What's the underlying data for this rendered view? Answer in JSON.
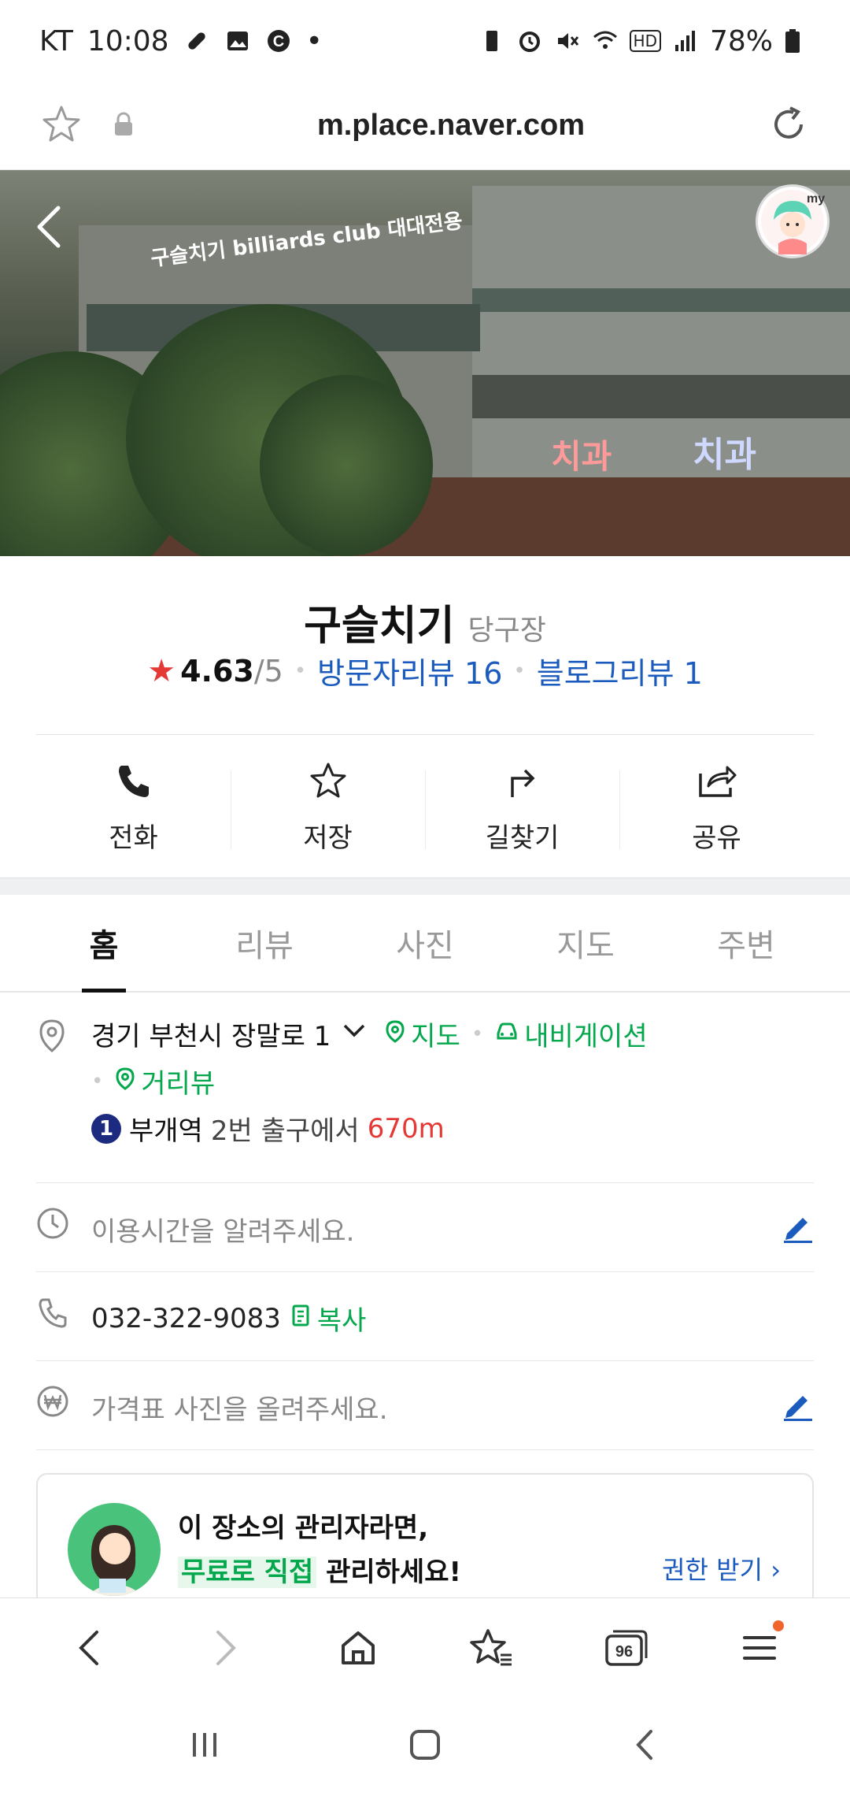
{
  "status_bar": {
    "carrier": "KT",
    "time": "10:08",
    "dot": "•",
    "hd": "HD",
    "battery": "78%"
  },
  "url_bar": {
    "url": "m.place.naver.com"
  },
  "hero": {
    "sign_text": "구슬치기 billiards club 대대전용",
    "sign_right": "치과",
    "sign_left": "치과"
  },
  "place": {
    "name": "구슬치기",
    "category": "당구장",
    "rating": "4.63",
    "rating_max": "/5",
    "visitor_reviews": "방문자리뷰 16",
    "blog_reviews": "블로그리뷰 1"
  },
  "actions": [
    {
      "label": "전화"
    },
    {
      "label": "저장"
    },
    {
      "label": "길찾기"
    },
    {
      "label": "공유"
    }
  ],
  "tabs": [
    {
      "label": "홈"
    },
    {
      "label": "리뷰"
    },
    {
      "label": "사진"
    },
    {
      "label": "지도"
    },
    {
      "label": "주변"
    }
  ],
  "info": {
    "address": "경기 부천시 장말로 1",
    "map_link": "지도",
    "navi_link": "내비게이션",
    "street_view": "거리뷰",
    "subway_line": "1",
    "station": "부개역",
    "exit_text": "2번 출구에서",
    "distance": "670m",
    "hours_placeholder": "이용시간을 알려주세요.",
    "phone": "032-322-9083",
    "copy_label": "복사",
    "price_placeholder": "가격표 사진을 올려주세요."
  },
  "promo": {
    "line1": "이 장소의 관리자라면,",
    "highlight": "무료로 직접",
    "line2_rest": " 관리하세요!",
    "link": "권한 받기",
    "link_chevron": "›"
  },
  "bottom_nav": {
    "tabs_count": "96"
  },
  "colors": {
    "green": "#03a74c",
    "blue": "#1a5bbd",
    "red": "#e53935"
  }
}
